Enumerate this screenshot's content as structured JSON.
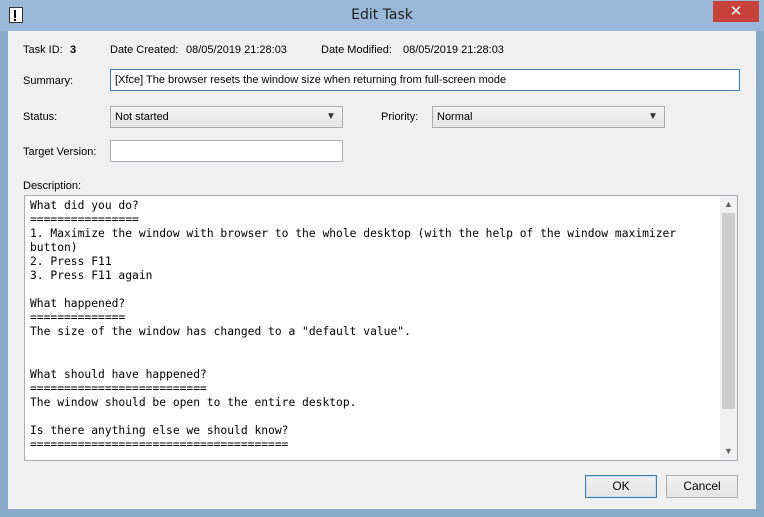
{
  "window": {
    "title": "Edit Task",
    "close_glyph": "✕",
    "icon": "task-dialog-icon"
  },
  "info": {
    "task_id_label": "Task ID:",
    "task_id_value": "3",
    "created_label": "Date Created:",
    "created_value": "08/05/2019 21:28:03",
    "modified_label": "Date Modified:",
    "modified_value": "08/05/2019 21:28:03"
  },
  "form": {
    "summary_label": "Summary:",
    "summary_value": "[Xfce] The browser resets the window size when returning from full-screen mode",
    "status_label": "Status:",
    "status_value": "Not started",
    "priority_label": "Priority:",
    "priority_value": "Normal",
    "target_version_label": "Target Version:",
    "target_version_value": "",
    "description_label": "Description:",
    "description_value": "What did you do?\n================\n1. Maximize the window with browser to the whole desktop (with the help of the window maximizer button)\n2. Press F11\n3. Press F11 again\n\nWhat happened?\n==============\nThe size of the window has changed to a \"default value\".\n\n\nWhat should have happened?\n==========================\nThe window should be open to the entire desktop.\n\nIs there anything else we should know?\n======================================"
  },
  "icons": {
    "dropdown": "▼",
    "scroll_up": "▲",
    "scroll_down": "▼"
  },
  "buttons": {
    "ok_label": "OK",
    "cancel_label": "Cancel"
  },
  "colors": {
    "title_bar": "#9ab8d8",
    "close_button": "#c7403a",
    "focus_border": "#3c7fb1"
  }
}
